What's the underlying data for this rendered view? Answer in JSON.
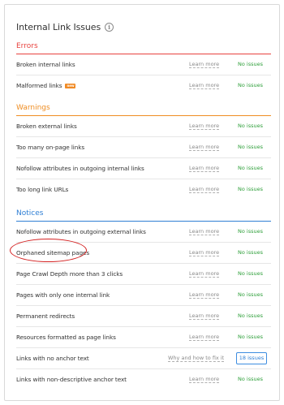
{
  "panel": {
    "title": "Internal Link Issues",
    "info_icon": "info-circle-icon"
  },
  "sections": [
    {
      "title": "Errors",
      "color": "#e8433f",
      "rows": [
        {
          "label": "Broken internal links",
          "badge": "",
          "link": "Learn more",
          "status": "No issues"
        },
        {
          "label": "Malformed links",
          "badge": "new",
          "link": "Learn more",
          "status": "No issues"
        }
      ]
    },
    {
      "title": "Warnings",
      "color": "#ef8d22",
      "rows": [
        {
          "label": "Broken external links",
          "badge": "",
          "link": "Learn more",
          "status": "No issues"
        },
        {
          "label": "Too many on-page links",
          "badge": "",
          "link": "Learn more",
          "status": "No issues"
        },
        {
          "label": "Nofollow attributes in outgoing internal links",
          "badge": "",
          "link": "Learn more",
          "status": "No issues"
        },
        {
          "label": "Too long link URLs",
          "badge": "",
          "link": "Learn more",
          "status": "No issues"
        }
      ]
    },
    {
      "title": "Notices",
      "color": "#2f7fd4",
      "rows": [
        {
          "label": "Nofollow attributes in outgoing external links",
          "badge": "",
          "link": "Learn more",
          "status": "No issues"
        },
        {
          "label": "Orphaned sitemap pages",
          "badge": "",
          "link": "Learn more",
          "status": "No issues"
        },
        {
          "label": "Page Crawl Depth more than 3 clicks",
          "badge": "",
          "link": "Learn more",
          "status": "No issues"
        },
        {
          "label": "Pages with only one internal link",
          "badge": "",
          "link": "Learn more",
          "status": "No issues"
        },
        {
          "label": "Permanent redirects",
          "badge": "",
          "link": "Learn more",
          "status": "No issues"
        },
        {
          "label": "Resources formatted as page links",
          "badge": "",
          "link": "Learn more",
          "status": "No issues"
        },
        {
          "label": "Links with no anchor text",
          "badge": "",
          "link": "Why and how to fix it",
          "status": "18 issues",
          "status_style": "button"
        },
        {
          "label": "Links with non-descriptive anchor text",
          "badge": "",
          "link": "Learn more",
          "status": "No issues"
        }
      ]
    }
  ],
  "colors": {
    "ok_status": "#2e9f3a",
    "issue_button": "#2f7fd4",
    "annotation": "#d42020"
  }
}
